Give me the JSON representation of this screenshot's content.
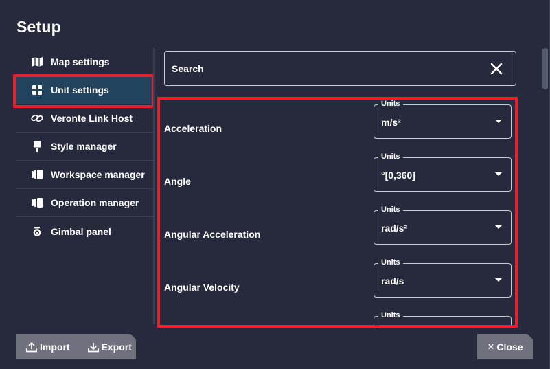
{
  "dialog": {
    "title": "Setup"
  },
  "sidebar": {
    "items": [
      {
        "label": "Map settings",
        "icon": "map-icon"
      },
      {
        "label": "Unit settings",
        "icon": "grid-icon"
      },
      {
        "label": "Veronte Link Host",
        "icon": "link-icon"
      },
      {
        "label": "Style manager",
        "icon": "brush-icon"
      },
      {
        "label": "Workspace manager",
        "icon": "cards-icon"
      },
      {
        "label": "Operation manager",
        "icon": "cards-icon"
      },
      {
        "label": "Gimbal panel",
        "icon": "camera-icon"
      }
    ],
    "active_index": 1
  },
  "search": {
    "placeholder": "Search",
    "value": ""
  },
  "units": {
    "field_legend": "Units",
    "rows": [
      {
        "label": "Acceleration",
        "value": "m/s²"
      },
      {
        "label": "Angle",
        "value": "°[0,360]"
      },
      {
        "label": "Angular Acceleration",
        "value": "rad/s²"
      },
      {
        "label": "Angular Velocity",
        "value": "rad/s"
      },
      {
        "label": "",
        "value": ""
      }
    ]
  },
  "footer": {
    "import_label": "Import",
    "export_label": "Export",
    "close_label": "Close"
  },
  "colors": {
    "background": "#272a3d",
    "active_item": "#22435e",
    "highlight": "#e8202a",
    "footer_button": "#6f727e"
  }
}
